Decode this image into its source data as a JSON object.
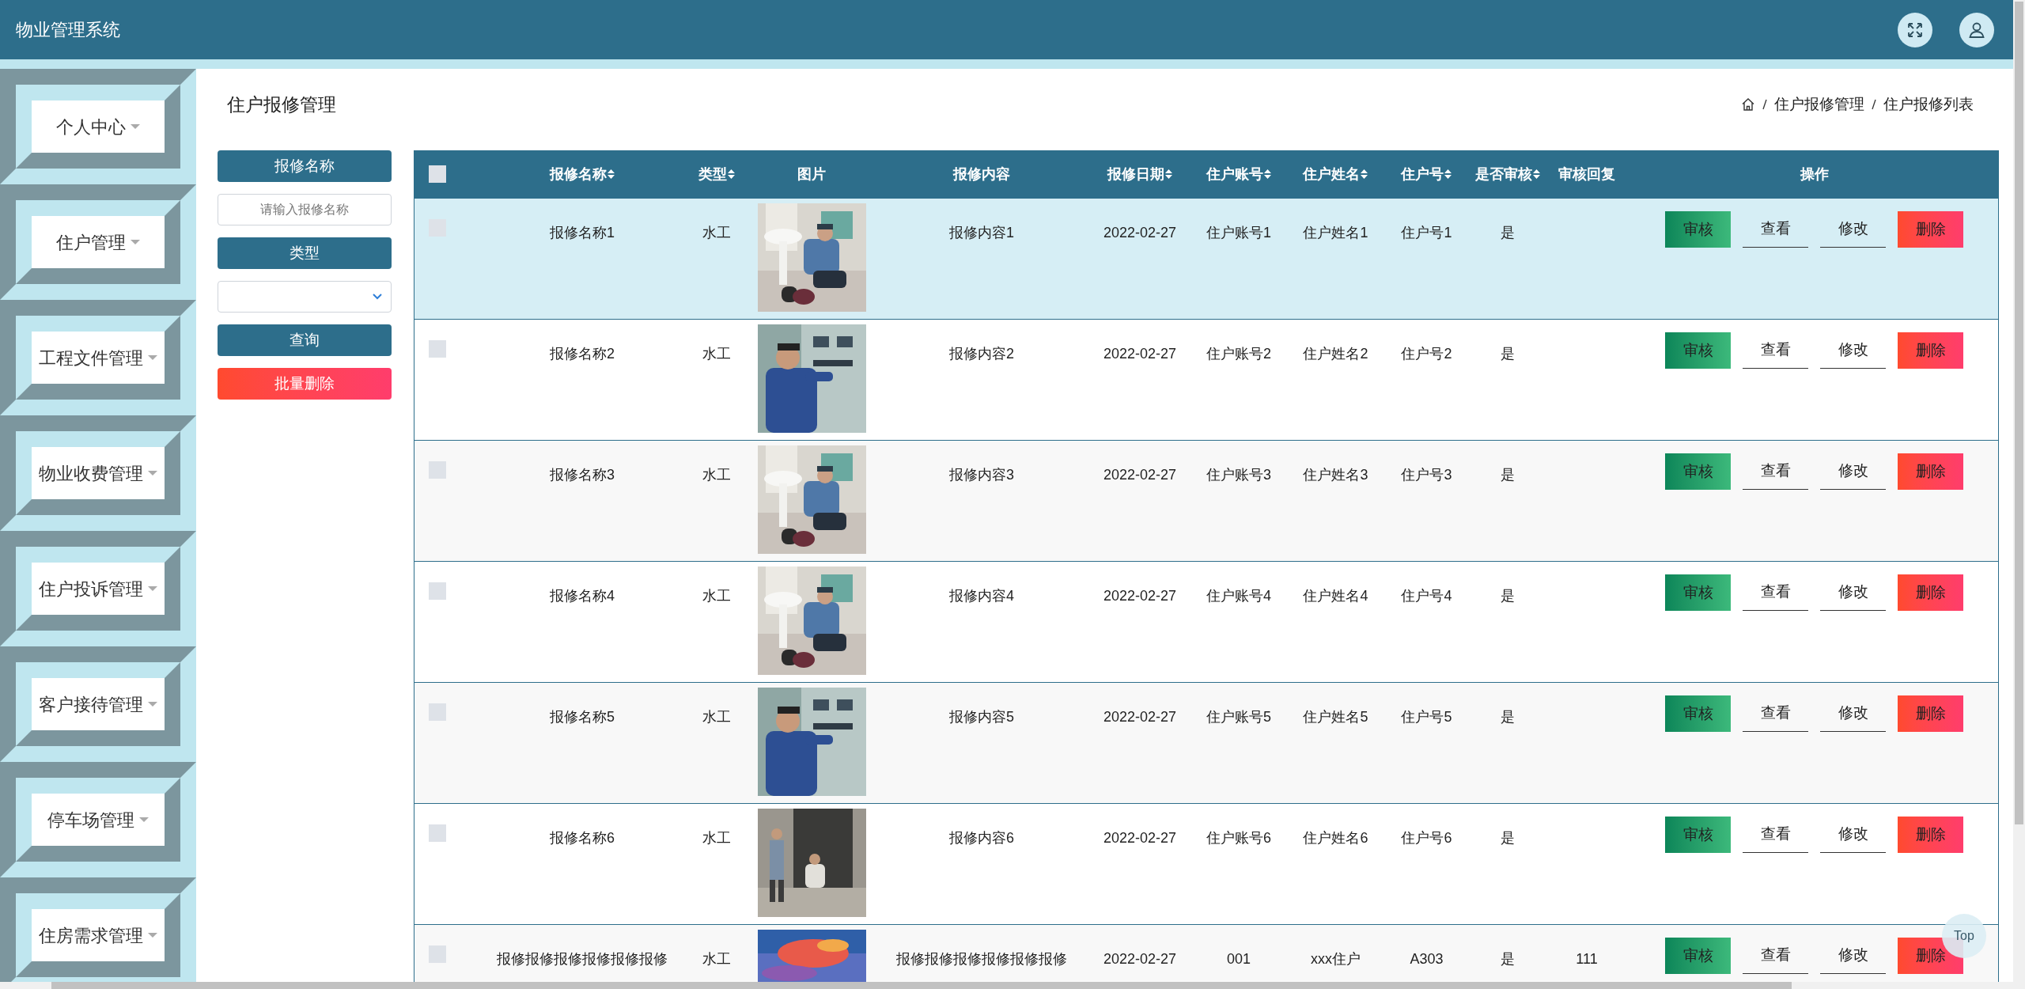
{
  "app": {
    "title": "物业管理系统"
  },
  "sidebar": {
    "items": [
      {
        "label": "个人中心",
        "expanded": false
      },
      {
        "label": "住户管理",
        "expanded": false
      },
      {
        "label": "工程文件管理",
        "expanded": false
      },
      {
        "label": "物业收费管理",
        "expanded": false
      },
      {
        "label": "住户投诉管理",
        "expanded": false
      },
      {
        "label": "客户接待管理",
        "expanded": false
      },
      {
        "label": "停车场管理",
        "expanded": false
      },
      {
        "label": "住房需求管理",
        "expanded": false
      }
    ]
  },
  "page": {
    "title": "住户报修管理",
    "breadcrumb": [
      "住户报修管理",
      "住户报修列表"
    ]
  },
  "filters": {
    "name_label": "报修名称",
    "name_input": {
      "placeholder": "请输入报修名称"
    },
    "type_label": "类型",
    "search_button": "查询",
    "batch_delete_button": "批量删除"
  },
  "table": {
    "select_all_checked": false,
    "columns": [
      {
        "label": "报修名称",
        "sortable": true
      },
      {
        "label": "类型",
        "sortable": true
      },
      {
        "label": "图片",
        "sortable": false
      },
      {
        "label": "报修内容",
        "sortable": false
      },
      {
        "label": "报修日期",
        "sortable": true
      },
      {
        "label": "住户账号",
        "sortable": true
      },
      {
        "label": "住户姓名",
        "sortable": true
      },
      {
        "label": "住户号",
        "sortable": true
      },
      {
        "label": "是否审核",
        "sortable": true
      },
      {
        "label": "审核回复",
        "sortable": false
      },
      {
        "label": "操作",
        "sortable": false
      }
    ],
    "rows": [
      {
        "checked": false,
        "highlighted": true,
        "name": "报修名称1",
        "type": "水工",
        "content": "报修内容1",
        "date": "2022-02-27",
        "account": "住户账号1",
        "resident_name": "住户姓名1",
        "unit": "住户号1",
        "audited": "是",
        "actions": [
          {
            "label": "审核",
            "kind": "approve"
          },
          {
            "label": "查看",
            "kind": "plain"
          },
          {
            "label": "修改",
            "kind": "plain"
          },
          {
            "label": "删除",
            "kind": "danger"
          }
        ]
      },
      {
        "checked": false,
        "highlighted": false,
        "name": "报修名称2",
        "type": "水工",
        "content": "报修内容2",
        "date": "2022-02-27",
        "account": "住户账号2",
        "resident_name": "住户姓名2",
        "unit": "住户号2",
        "audited": "是",
        "actions": [
          {
            "label": "审核",
            "kind": "approve"
          },
          {
            "label": "查看",
            "kind": "plain"
          },
          {
            "label": "修改",
            "kind": "plain"
          },
          {
            "label": "删除",
            "kind": "danger"
          }
        ]
      },
      {
        "checked": false,
        "highlighted": false,
        "name": "报修名称3",
        "type": "水工",
        "content": "报修内容3",
        "date": "2022-02-27",
        "account": "住户账号3",
        "resident_name": "住户姓名3",
        "unit": "住户号3",
        "audited": "是",
        "actions": [
          {
            "label": "审核",
            "kind": "approve"
          },
          {
            "label": "查看",
            "kind": "plain"
          },
          {
            "label": "修改",
            "kind": "plain"
          },
          {
            "label": "删除",
            "kind": "danger"
          }
        ]
      },
      {
        "checked": false,
        "highlighted": false,
        "name": "报修名称4",
        "type": "水工",
        "content": "报修内容4",
        "date": "2022-02-27",
        "account": "住户账号4",
        "resident_name": "住户姓名4",
        "unit": "住户号4",
        "audited": "是",
        "actions": [
          {
            "label": "审核",
            "kind": "approve"
          },
          {
            "label": "查看",
            "kind": "plain"
          },
          {
            "label": "修改",
            "kind": "plain"
          },
          {
            "label": "删除",
            "kind": "danger"
          }
        ]
      },
      {
        "checked": false,
        "highlighted": false,
        "name": "报修名称5",
        "type": "水工",
        "content": "报修内容5",
        "date": "2022-02-27",
        "account": "住户账号5",
        "resident_name": "住户姓名5",
        "unit": "住户号5",
        "audited": "是",
        "actions": [
          {
            "label": "审核",
            "kind": "approve"
          },
          {
            "label": "查看",
            "kind": "plain"
          },
          {
            "label": "修改",
            "kind": "plain"
          },
          {
            "label": "删除",
            "kind": "danger"
          }
        ]
      },
      {
        "checked": false,
        "highlighted": false,
        "name": "报修名称6",
        "type": "水工",
        "content": "报修内容6",
        "date": "2022-02-27",
        "account": "住户账号6",
        "resident_name": "住户姓名6",
        "unit": "住户号6",
        "audited": "是",
        "actions": [
          {
            "label": "审核",
            "kind": "approve"
          },
          {
            "label": "查看",
            "kind": "plain"
          },
          {
            "label": "修改",
            "kind": "plain"
          },
          {
            "label": "删除",
            "kind": "danger"
          }
        ]
      },
      {
        "checked": false,
        "highlighted": false,
        "name": "报修报修报修报修报修报修",
        "type": "水工",
        "content": "报修报修报修报修报修报修",
        "date": "2022-02-27",
        "account": "001",
        "resident_name": "xxx住户",
        "unit": "A303",
        "audited": "是",
        "reply": "111",
        "actions": [
          {
            "label": "审核",
            "kind": "approve"
          },
          {
            "label": "查看",
            "kind": "plain"
          },
          {
            "label": "修改",
            "kind": "plain"
          },
          {
            "label": "删除",
            "kind": "danger"
          }
        ]
      }
    ]
  },
  "back_to_top": "Top"
}
